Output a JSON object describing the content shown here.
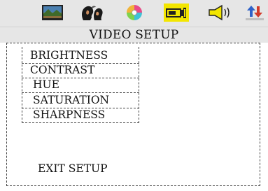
{
  "tabs": [
    {
      "name": "general-setup",
      "icon": "tv-picture-icon"
    },
    {
      "name": "language-setup",
      "icon": "faces-icon"
    },
    {
      "name": "disc-setup",
      "icon": "disc-icon"
    },
    {
      "name": "video-setup",
      "icon": "projector-icon",
      "active": true
    },
    {
      "name": "speaker-setup",
      "icon": "speaker-icon"
    },
    {
      "name": "preference-setup",
      "icon": "arrows-icon"
    }
  ],
  "title": "VIDEO SETUP",
  "menu": {
    "items": [
      {
        "label": "BRIGHTNESS"
      },
      {
        "label": "CONTRAST"
      },
      {
        "label": "HUE"
      },
      {
        "label": "SATURATION"
      },
      {
        "label": "SHARPNESS"
      }
    ],
    "exit_label": "EXIT SETUP"
  },
  "colors": {
    "topbar_bg": "#e6e6e6",
    "active_tab": "#f3e600"
  }
}
